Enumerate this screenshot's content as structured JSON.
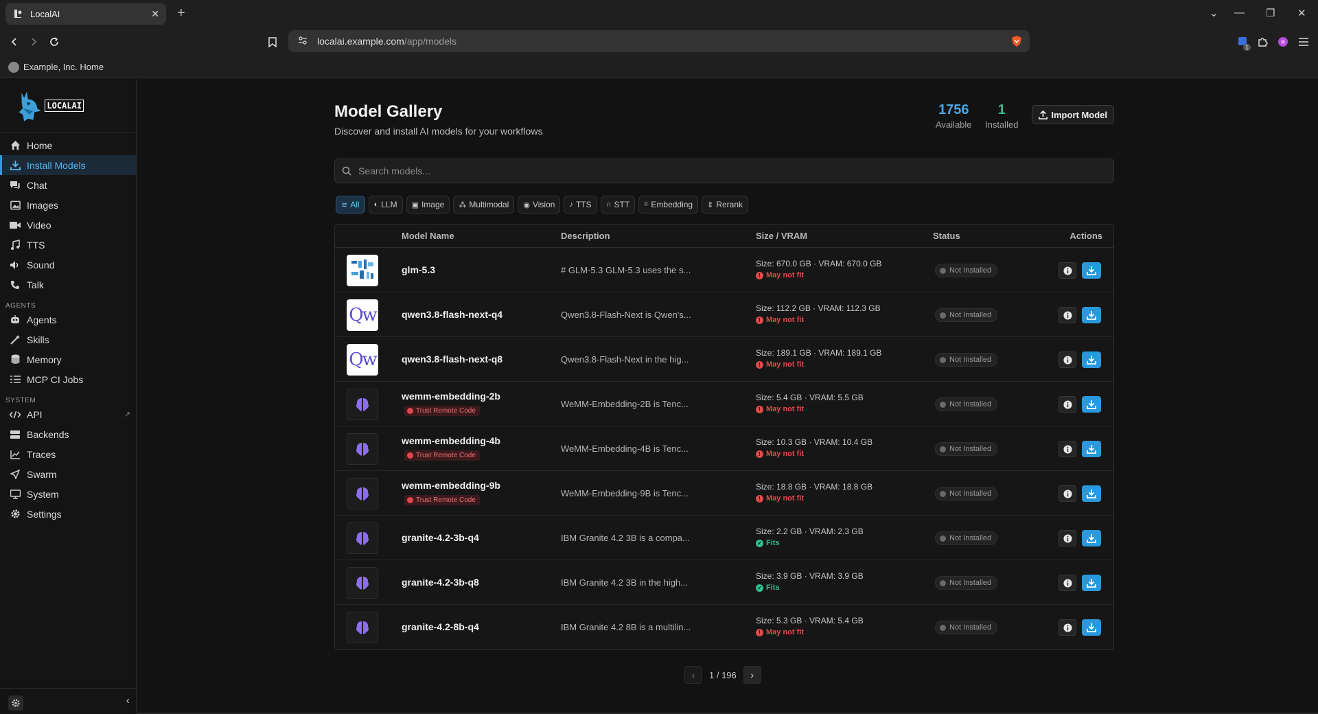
{
  "browser": {
    "tab_title": "LocalAI",
    "url_host": "localai.example.com",
    "url_path": "/app/models",
    "bookmark": "Example, Inc. Home",
    "ext_badge": "1"
  },
  "sidebar": {
    "logo_text": "LOCALAI",
    "items": [
      {
        "label": "Home",
        "icon": "home-icon"
      },
      {
        "label": "Install Models",
        "icon": "download-icon"
      },
      {
        "label": "Chat",
        "icon": "chat-icon"
      },
      {
        "label": "Images",
        "icon": "image-icon"
      },
      {
        "label": "Video",
        "icon": "video-icon"
      },
      {
        "label": "TTS",
        "icon": "music-icon"
      },
      {
        "label": "Sound",
        "icon": "sound-icon"
      },
      {
        "label": "Talk",
        "icon": "phone-icon"
      }
    ],
    "agents_label": "AGENTS",
    "agents_items": [
      {
        "label": "Agents",
        "icon": "robot-icon"
      },
      {
        "label": "Skills",
        "icon": "wand-icon"
      },
      {
        "label": "Memory",
        "icon": "database-icon"
      },
      {
        "label": "MCP CI Jobs",
        "icon": "list-icon"
      }
    ],
    "system_label": "SYSTEM",
    "system_items": [
      {
        "label": "API",
        "icon": "code-icon"
      },
      {
        "label": "Backends",
        "icon": "server-icon"
      },
      {
        "label": "Traces",
        "icon": "chart-icon"
      },
      {
        "label": "Swarm",
        "icon": "send-icon"
      },
      {
        "label": "System",
        "icon": "monitor-icon"
      },
      {
        "label": "Settings",
        "icon": "gear-icon"
      }
    ]
  },
  "header": {
    "title": "Model Gallery",
    "subtitle": "Discover and install AI models for your workflows",
    "available_count": "1756",
    "available_label": "Available",
    "installed_count": "1",
    "installed_label": "Installed",
    "import_label": "Import Model",
    "available_color": "#4aa8e8",
    "installed_color": "#2fbf8a"
  },
  "search": {
    "placeholder": "Search models..."
  },
  "filters": [
    "All",
    "LLM",
    "Image",
    "Multimodal",
    "Vision",
    "TTS",
    "STT",
    "Embedding",
    "Rerank"
  ],
  "table": {
    "columns": [
      "Model Name",
      "Description",
      "Size / VRAM",
      "Status",
      "Actions"
    ],
    "rows": [
      {
        "name": "glm-5.3",
        "thumb": "glm",
        "trust": "",
        "desc": "# GLM-5.3 GLM-5.3 uses the s...",
        "size": "Size: 670.0 GB · VRAM: 670.0 GB",
        "fit": "May not fit",
        "fit_ok": false,
        "status": "Not Installed"
      },
      {
        "name": "qwen3.8-flash-next-q4",
        "thumb": "qw",
        "trust": "",
        "desc": "Qwen3.8-Flash-Next is Qwen's...",
        "size": "Size: 112.2 GB · VRAM: 112.3 GB",
        "fit": "May not fit",
        "fit_ok": false,
        "status": "Not Installed"
      },
      {
        "name": "qwen3.8-flash-next-q8",
        "thumb": "qw",
        "trust": "",
        "desc": "Qwen3.8-Flash-Next in the hig...",
        "size": "Size: 189.1 GB · VRAM: 189.1 GB",
        "fit": "May not fit",
        "fit_ok": false,
        "status": "Not Installed"
      },
      {
        "name": "wemm-embedding-2b",
        "thumb": "brain",
        "trust": "Trust Remote Code",
        "desc": "WeMM-Embedding-2B is Tenc...",
        "size": "Size: 5.4 GB · VRAM: 5.5 GB",
        "fit": "May not fit",
        "fit_ok": false,
        "status": "Not Installed"
      },
      {
        "name": "wemm-embedding-4b",
        "thumb": "brain",
        "trust": "Trust Remote Code",
        "desc": "WeMM-Embedding-4B is Tenc...",
        "size": "Size: 10.3 GB · VRAM: 10.4 GB",
        "fit": "May not fit",
        "fit_ok": false,
        "status": "Not Installed"
      },
      {
        "name": "wemm-embedding-9b",
        "thumb": "brain",
        "trust": "Trust Remote Code",
        "desc": "WeMM-Embedding-9B is Tenc...",
        "size": "Size: 18.8 GB · VRAM: 18.8 GB",
        "fit": "May not fit",
        "fit_ok": false,
        "status": "Not Installed"
      },
      {
        "name": "granite-4.2-3b-q4",
        "thumb": "brain",
        "trust": "",
        "desc": "IBM Granite 4.2 3B is a compa...",
        "size": "Size: 2.2 GB · VRAM: 2.3 GB",
        "fit": "Fits",
        "fit_ok": true,
        "status": "Not Installed"
      },
      {
        "name": "granite-4.2-3b-q8",
        "thumb": "brain",
        "trust": "",
        "desc": "IBM Granite 4.2 3B in the high...",
        "size": "Size: 3.9 GB · VRAM: 3.9 GB",
        "fit": "Fits",
        "fit_ok": true,
        "status": "Not Installed"
      },
      {
        "name": "granite-4.2-8b-q4",
        "thumb": "brain",
        "trust": "",
        "desc": "IBM Granite 4.2 8B is a multilin...",
        "size": "Size: 5.3 GB · VRAM: 5.4 GB",
        "fit": "May not fit",
        "fit_ok": false,
        "status": "Not Installed"
      }
    ]
  },
  "pagination": {
    "text": "1 / 196"
  }
}
